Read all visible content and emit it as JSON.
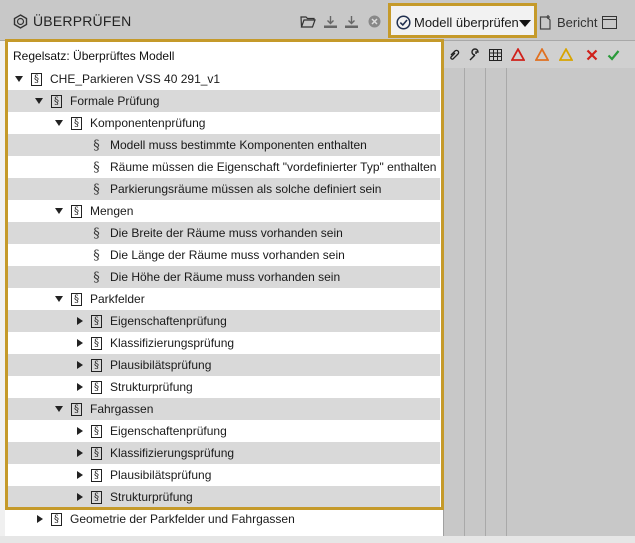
{
  "header": {
    "title": "ÜBERPRÜFEN",
    "check_button_label": "Modell überprüfen",
    "report_label": "Bericht",
    "icons": [
      "open-folder-icon",
      "download-icon",
      "download-all-icon",
      "close-circle-icon",
      "checkmark-circle-icon",
      "report-icon",
      "layout-icon"
    ]
  },
  "tree": {
    "ruleset_label": "Regelsatz: Überprüftes Modell",
    "rows": [
      {
        "label": "CHE_Parkieren VSS 40 291_v1",
        "level": 0,
        "toggle": "open",
        "type": "group"
      },
      {
        "label": "Formale Prüfung",
        "level": 1,
        "toggle": "open",
        "type": "group"
      },
      {
        "label": "Komponentenprüfung",
        "level": 2,
        "toggle": "open",
        "type": "group"
      },
      {
        "label": "Modell muss bestimmte Komponenten enthalten",
        "level": 3,
        "toggle": "none",
        "type": "rule"
      },
      {
        "label": "Räume müssen die Eigenschaft \"vordefinierter Typ\" enthalten",
        "level": 3,
        "toggle": "none",
        "type": "rule"
      },
      {
        "label": "Parkierungsräume müssen als solche definiert sein",
        "level": 3,
        "toggle": "none",
        "type": "rule"
      },
      {
        "label": "Mengen",
        "level": 2,
        "toggle": "open",
        "type": "group"
      },
      {
        "label": "Die Breite der Räume muss vorhanden sein",
        "level": 3,
        "toggle": "none",
        "type": "rule"
      },
      {
        "label": "Die Länge der Räume muss vorhanden sein",
        "level": 3,
        "toggle": "none",
        "type": "rule"
      },
      {
        "label": "Die Höhe der Räume muss vorhanden sein",
        "level": 3,
        "toggle": "none",
        "type": "rule"
      },
      {
        "label": "Parkfelder",
        "level": 2,
        "toggle": "open",
        "type": "group"
      },
      {
        "label": "Eigenschaftenprüfung",
        "level": 3,
        "toggle": "closed",
        "type": "group"
      },
      {
        "label": "Klassifizierungsprüfung",
        "level": 3,
        "toggle": "closed",
        "type": "group"
      },
      {
        "label": "Plausibilätsprüfung",
        "level": 3,
        "toggle": "closed",
        "type": "group"
      },
      {
        "label": "Strukturprüfung",
        "level": 3,
        "toggle": "closed",
        "type": "group"
      },
      {
        "label": "Fahrgassen",
        "level": 2,
        "toggle": "open",
        "type": "group"
      },
      {
        "label": "Eigenschaftenprüfung",
        "level": 3,
        "toggle": "closed",
        "type": "group"
      },
      {
        "label": "Klassifizierungsprüfung",
        "level": 3,
        "toggle": "closed",
        "type": "group"
      },
      {
        "label": "Plausibilätsprüfung",
        "level": 3,
        "toggle": "closed",
        "type": "group"
      },
      {
        "label": "Strukturprüfung",
        "level": 3,
        "toggle": "closed",
        "type": "group"
      },
      {
        "label": "Geometrie der Parkfelder und Fahrgassen",
        "level": 1,
        "toggle": "closed",
        "type": "group"
      }
    ]
  },
  "columns": {
    "icons": [
      "paperclip-icon",
      "wrench-icon",
      "table-icon",
      "red-warning-icon",
      "orange-warning-icon",
      "yellow-warning-icon",
      "red-x-icon",
      "green-check-icon"
    ],
    "colors": {
      "highlight": "#c59a2a",
      "red": "#d0201a",
      "orange": "#e07020",
      "yellow": "#d8a400",
      "green": "#2a9a3a"
    }
  }
}
